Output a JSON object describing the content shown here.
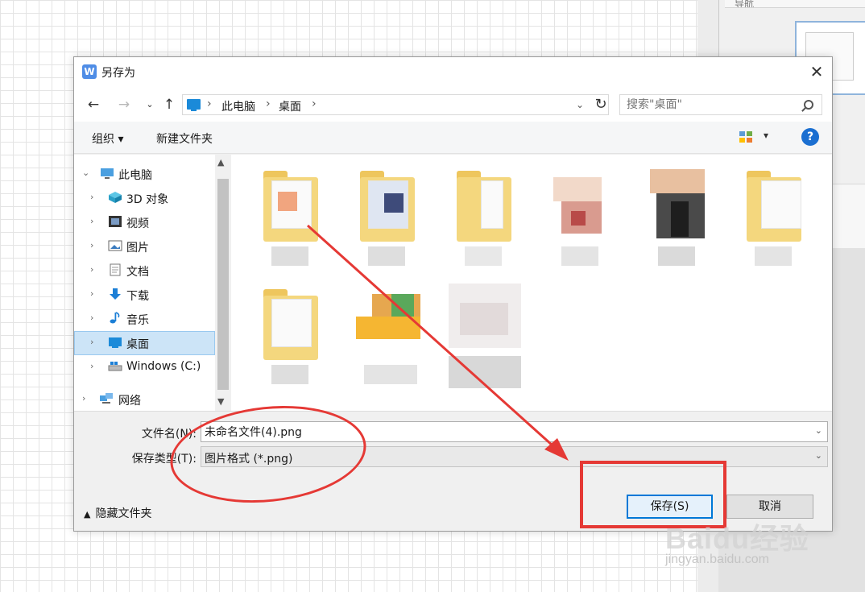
{
  "window": {
    "title": "另存为",
    "app_icon_glyph": "W"
  },
  "navigation": {
    "back_icon": "arrow-left-icon",
    "forward_icon": "arrow-right-icon",
    "up_icon": "arrow-up-icon",
    "path": [
      "此电脑",
      "桌面"
    ],
    "search_placeholder": "搜索\"桌面\""
  },
  "toolbar": {
    "organize_label": "组织 ▾",
    "new_folder_label": "新建文件夹",
    "help_label": "?"
  },
  "tree": {
    "items": [
      {
        "label": "此电脑",
        "icon": "computer-icon"
      },
      {
        "label": "3D 对象",
        "icon": "cube-icon"
      },
      {
        "label": "视频",
        "icon": "video-icon"
      },
      {
        "label": "图片",
        "icon": "picture-icon"
      },
      {
        "label": "文档",
        "icon": "document-icon"
      },
      {
        "label": "下载",
        "icon": "download-icon"
      },
      {
        "label": "音乐",
        "icon": "music-icon"
      },
      {
        "label": "桌面",
        "icon": "desktop-icon",
        "selected": true
      },
      {
        "label": "Windows (C:)",
        "icon": "drive-icon"
      },
      {
        "label": "网络",
        "icon": "network-icon"
      }
    ]
  },
  "form": {
    "filename_label": "文件名(N):",
    "filename_value": "未命名文件(4).png",
    "filetype_label": "保存类型(T):",
    "filetype_value": "图片格式 (*.png)"
  },
  "footer": {
    "hide_folders_label": "隐藏文件夹",
    "save_label": "保存(S)",
    "cancel_label": "取消"
  },
  "background": {
    "panel_title": "导航"
  },
  "watermark": {
    "brand": "Baidu经验",
    "url": "jingyan.baidu.com"
  },
  "colors": {
    "accent": "#0078d7",
    "annotation": "#e53935",
    "selection": "#cce4f7"
  }
}
